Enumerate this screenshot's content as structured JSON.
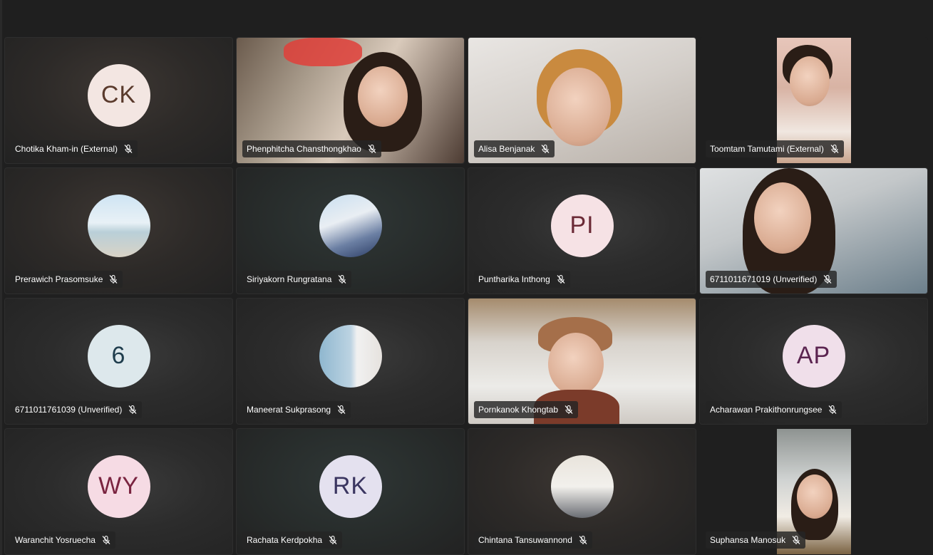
{
  "participants": [
    {
      "name": "Chotika Kham-in (External)",
      "initials": "CK",
      "type": "initials"
    },
    {
      "name": "Phenphitcha Chansthongkhao",
      "type": "video"
    },
    {
      "name": "Alisa Benjanak",
      "type": "video"
    },
    {
      "name": "Toomtam Tamutami (External)",
      "type": "video-portrait"
    },
    {
      "name": "Prerawich Prasomsuke",
      "type": "photo"
    },
    {
      "name": "Siriyakorn Rungratana",
      "type": "photo"
    },
    {
      "name": "Puntharika Inthong",
      "initials": "PI",
      "type": "initials"
    },
    {
      "name": "6711011671019 (Unverified)",
      "type": "video"
    },
    {
      "name": "6711011761039 (Unverified)",
      "initials": "6",
      "type": "initials"
    },
    {
      "name": "Maneerat Sukprasong",
      "type": "photo"
    },
    {
      "name": "Pornkanok Khongtab",
      "type": "video"
    },
    {
      "name": "Acharawan Prakithonrungsee",
      "initials": "AP",
      "type": "initials"
    },
    {
      "name": "Waranchit Yosruecha",
      "initials": "WY",
      "type": "initials"
    },
    {
      "name": "Rachata Kerdpokha",
      "initials": "RK",
      "type": "initials"
    },
    {
      "name": "Chintana Tansuwannond",
      "type": "photo"
    },
    {
      "name": "Suphansa Manosuk",
      "type": "video-portrait"
    }
  ],
  "icons": {
    "muted": "mic-off-icon"
  }
}
